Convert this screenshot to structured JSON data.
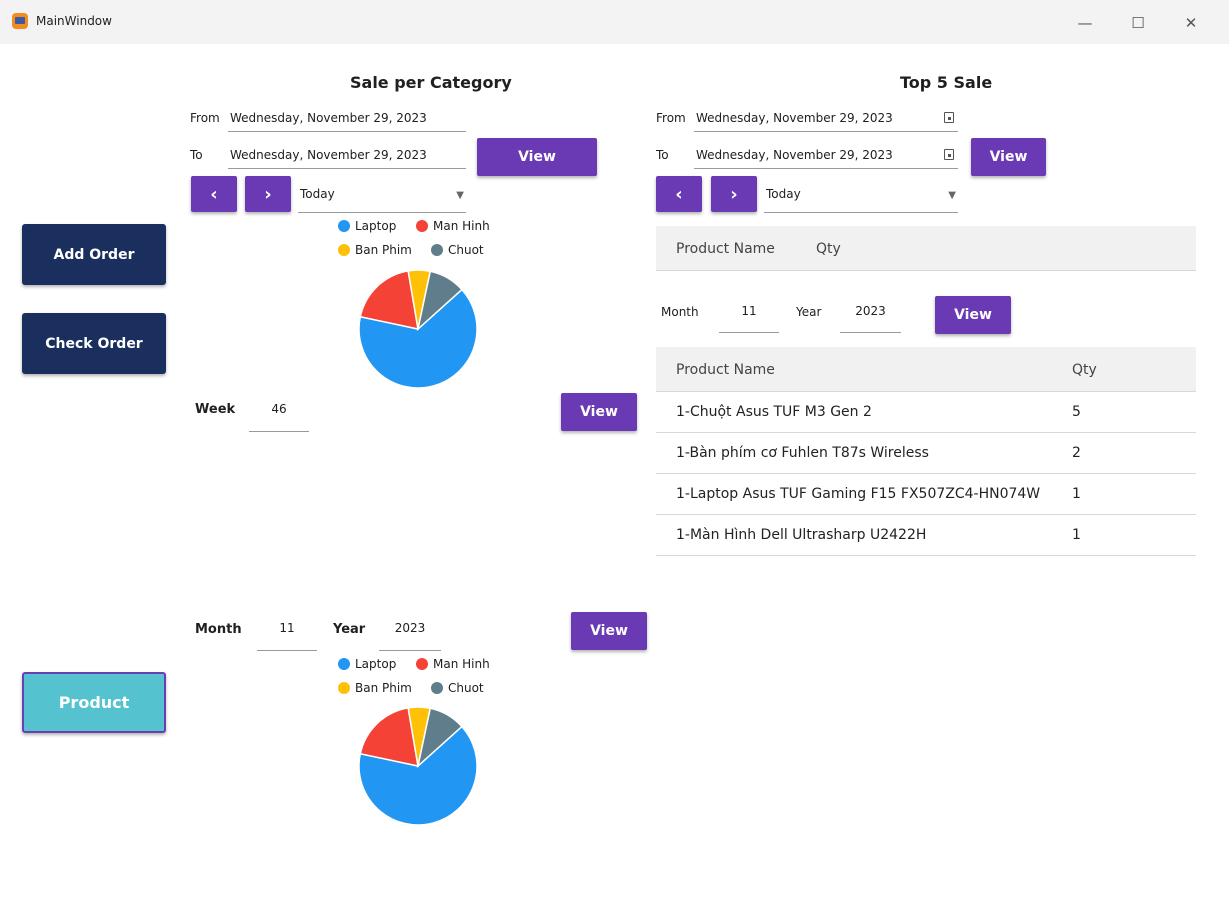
{
  "window": {
    "title": "MainWindow",
    "minimize": "—",
    "maximize": "☐",
    "close": "✕"
  },
  "nav": {
    "add_order": "Add Order",
    "check_order": "Check Order",
    "product": "Product"
  },
  "sale_per_category": {
    "title": "Sale per Category",
    "from_label": "From",
    "from_value": "Wednesday, November 29, 2023",
    "to_label": "To",
    "to_value": "Wednesday, November 29, 2023",
    "view": "View",
    "prev": "‹",
    "next": "›",
    "period": "Today",
    "week_label": "Week",
    "week_value": "46",
    "week_view": "View",
    "month_label": "Month",
    "month_value": "11",
    "year_label": "Year",
    "year_value": "2023",
    "month_view": "View"
  },
  "legend": [
    {
      "label": "Laptop",
      "color": "#2196f3"
    },
    {
      "label": "Man Hinh",
      "color": "#f44336"
    },
    {
      "label": "Ban Phim",
      "color": "#ffc107"
    },
    {
      "label": "Chuot",
      "color": "#607d8b"
    }
  ],
  "chart_data": [
    {
      "type": "pie",
      "categories": [
        "Laptop",
        "Man Hinh",
        "Ban Phim",
        "Chuot"
      ],
      "values": [
        65,
        19,
        6,
        10
      ]
    },
    {
      "type": "pie",
      "categories": [
        "Laptop",
        "Man Hinh",
        "Ban Phim",
        "Chuot"
      ],
      "values": [
        65,
        19,
        6,
        10
      ]
    }
  ],
  "top5": {
    "title": "Top 5 Sale",
    "from_label": "From",
    "from_value": "Wednesday, November 29, 2023",
    "to_label": "To",
    "to_value": "Wednesday, November 29, 2023",
    "view": "View",
    "prev": "‹",
    "next": "›",
    "period": "Today",
    "col_product": "Product Name",
    "col_qty": "Qty",
    "month_label": "Month",
    "month_value": "11",
    "year_label": "Year",
    "year_value": "2023",
    "month_view": "View",
    "table_col_product": "Product Name",
    "table_col_qty": "Qty",
    "rows": [
      {
        "name": "1-Chuột Asus TUF M3 Gen 2",
        "qty": "5"
      },
      {
        "name": "1-Bàn phím cơ Fuhlen T87s Wireless",
        "qty": "2"
      },
      {
        "name": "1-Laptop Asus TUF Gaming F15 FX507ZC4-HN074W",
        "qty": "1"
      },
      {
        "name": "1-Màn Hình Dell Ultrasharp U2422H",
        "qty": "1"
      }
    ]
  }
}
